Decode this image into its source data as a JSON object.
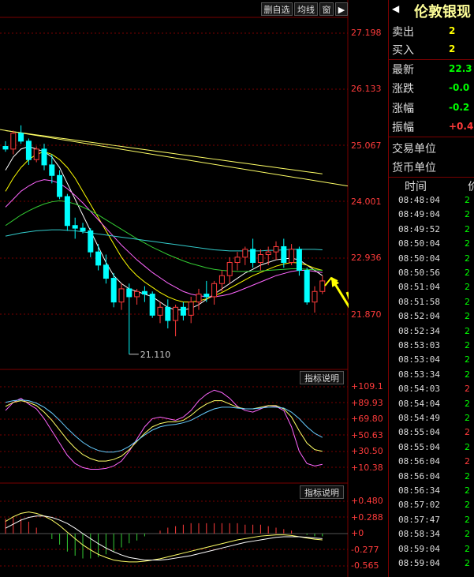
{
  "toolbar": {
    "buttons": [
      "删自选",
      "均线",
      "窗"
    ]
  },
  "chart_data": [
    {
      "type": "candlestick",
      "ylim": [
        20.0,
        27.6
      ],
      "y_ticks": [
        "27.198",
        "26.133",
        "25.067",
        "24.001",
        "22.936",
        "21.870"
      ],
      "low_annotation": "21.110",
      "candles": [
        {
          "o": 25.05,
          "h": 25.15,
          "l": 24.95,
          "c": 25.0
        },
        {
          "o": 25.0,
          "h": 25.35,
          "l": 24.9,
          "c": 25.3
        },
        {
          "o": 25.3,
          "h": 25.45,
          "l": 25.1,
          "c": 25.15
        },
        {
          "o": 25.15,
          "h": 25.2,
          "l": 24.7,
          "c": 24.8
        },
        {
          "o": 24.8,
          "h": 25.05,
          "l": 24.75,
          "c": 25.0
        },
        {
          "o": 25.0,
          "h": 25.1,
          "l": 24.6,
          "c": 24.7
        },
        {
          "o": 24.7,
          "h": 24.9,
          "l": 24.35,
          "c": 24.5
        },
        {
          "o": 24.5,
          "h": 24.6,
          "l": 24.05,
          "c": 24.1
        },
        {
          "o": 24.1,
          "h": 24.15,
          "l": 23.45,
          "c": 23.55
        },
        {
          "o": 23.55,
          "h": 23.7,
          "l": 23.3,
          "c": 23.5
        },
        {
          "o": 23.5,
          "h": 23.6,
          "l": 23.4,
          "c": 23.45
        },
        {
          "o": 23.45,
          "h": 23.5,
          "l": 22.95,
          "c": 23.05
        },
        {
          "o": 23.05,
          "h": 23.2,
          "l": 22.7,
          "c": 22.8
        },
        {
          "o": 22.8,
          "h": 23.0,
          "l": 22.45,
          "c": 22.55
        },
        {
          "o": 22.55,
          "h": 22.65,
          "l": 22.0,
          "c": 22.1
        },
        {
          "o": 22.1,
          "h": 22.45,
          "l": 21.95,
          "c": 22.35
        },
        {
          "o": 22.35,
          "h": 22.45,
          "l": 21.11,
          "c": 22.2
        },
        {
          "o": 22.2,
          "h": 22.35,
          "l": 22.05,
          "c": 22.3
        },
        {
          "o": 22.3,
          "h": 22.4,
          "l": 22.1,
          "c": 22.25
        },
        {
          "o": 22.25,
          "h": 22.3,
          "l": 21.8,
          "c": 21.85
        },
        {
          "o": 21.85,
          "h": 22.1,
          "l": 21.7,
          "c": 22.0
        },
        {
          "o": 22.0,
          "h": 22.15,
          "l": 21.6,
          "c": 21.75
        },
        {
          "o": 21.75,
          "h": 22.05,
          "l": 21.45,
          "c": 22.0
        },
        {
          "o": 22.0,
          "h": 22.1,
          "l": 21.75,
          "c": 21.85
        },
        {
          "o": 21.85,
          "h": 22.2,
          "l": 21.7,
          "c": 22.1
        },
        {
          "o": 22.1,
          "h": 22.35,
          "l": 21.95,
          "c": 22.25
        },
        {
          "o": 22.25,
          "h": 22.5,
          "l": 22.1,
          "c": 22.2
        },
        {
          "o": 22.2,
          "h": 22.5,
          "l": 22.05,
          "c": 22.45
        },
        {
          "o": 22.45,
          "h": 22.7,
          "l": 22.3,
          "c": 22.6
        },
        {
          "o": 22.6,
          "h": 22.95,
          "l": 22.45,
          "c": 22.85
        },
        {
          "o": 22.85,
          "h": 23.05,
          "l": 22.7,
          "c": 22.95
        },
        {
          "o": 22.95,
          "h": 23.15,
          "l": 22.8,
          "c": 23.1
        },
        {
          "o": 23.1,
          "h": 23.3,
          "l": 22.75,
          "c": 22.85
        },
        {
          "o": 22.85,
          "h": 23.1,
          "l": 22.7,
          "c": 23.0
        },
        {
          "o": 23.0,
          "h": 23.15,
          "l": 22.8,
          "c": 23.05
        },
        {
          "o": 23.05,
          "h": 23.25,
          "l": 22.9,
          "c": 23.15
        },
        {
          "o": 23.15,
          "h": 23.3,
          "l": 22.75,
          "c": 22.85
        },
        {
          "o": 22.85,
          "h": 23.2,
          "l": 22.8,
          "c": 23.1
        },
        {
          "o": 23.1,
          "h": 23.15,
          "l": 22.6,
          "c": 22.7
        },
        {
          "o": 22.7,
          "h": 22.75,
          "l": 22.05,
          "c": 22.1
        },
        {
          "o": 22.1,
          "h": 22.4,
          "l": 21.9,
          "c": 22.3
        },
        {
          "o": 22.3,
          "h": 22.6,
          "l": 22.25,
          "c": 22.5
        }
      ],
      "lines": [
        {
          "color": "#ffff66",
          "values": [
            25.35,
            25.33,
            25.31,
            25.29,
            25.27,
            25.25,
            25.23,
            25.21,
            25.19,
            25.17,
            25.15,
            25.13,
            25.11,
            25.09,
            25.07,
            25.05,
            25.03,
            25.01,
            24.99,
            24.97,
            24.95,
            24.93,
            24.91,
            24.89,
            24.87,
            24.85,
            24.83,
            24.81,
            24.79,
            24.77,
            24.75,
            24.73,
            24.71,
            24.69,
            24.67,
            24.65,
            24.63,
            24.61,
            24.59,
            24.57,
            24.55,
            24.53
          ]
        },
        {
          "color": "#ffffff",
          "values": [
            24.6,
            24.85,
            25.0,
            25.05,
            25.0,
            24.95,
            24.85,
            24.65,
            24.35,
            24.05,
            23.75,
            23.45,
            23.15,
            22.85,
            22.6,
            22.45,
            22.35,
            22.3,
            22.25,
            22.2,
            22.1,
            22.0,
            21.95,
            21.95,
            21.98,
            22.05,
            22.15,
            22.25,
            22.35,
            22.45,
            22.55,
            22.65,
            22.72,
            22.8,
            22.85,
            22.9,
            22.92,
            22.93,
            22.9,
            22.8,
            22.7,
            22.6
          ]
        },
        {
          "color": "#ffff00",
          "values": [
            24.2,
            24.45,
            24.65,
            24.8,
            24.9,
            24.95,
            24.9,
            24.8,
            24.65,
            24.45,
            24.2,
            23.95,
            23.7,
            23.45,
            23.2,
            22.95,
            22.75,
            22.6,
            22.48,
            22.38,
            22.28,
            22.2,
            22.14,
            22.1,
            22.1,
            22.12,
            22.16,
            22.22,
            22.28,
            22.36,
            22.44,
            22.52,
            22.6,
            22.66,
            22.72,
            22.78,
            22.82,
            22.85,
            22.84,
            22.8,
            22.74,
            22.7
          ]
        },
        {
          "color": "#ff66ff",
          "values": [
            23.9,
            24.05,
            24.2,
            24.3,
            24.38,
            24.42,
            24.4,
            24.35,
            24.25,
            24.12,
            23.98,
            23.82,
            23.66,
            23.5,
            23.34,
            23.18,
            23.04,
            22.9,
            22.78,
            22.66,
            22.56,
            22.46,
            22.38,
            22.3,
            22.25,
            22.22,
            22.2,
            22.2,
            22.22,
            22.25,
            22.3,
            22.36,
            22.42,
            22.48,
            22.54,
            22.6,
            22.64,
            22.68,
            22.7,
            22.7,
            22.68,
            22.66
          ]
        },
        {
          "color": "#33cc33",
          "values": [
            23.55,
            23.65,
            23.75,
            23.83,
            23.9,
            23.96,
            24.0,
            24.02,
            24.0,
            23.96,
            23.9,
            23.83,
            23.75,
            23.66,
            23.57,
            23.48,
            23.39,
            23.3,
            23.22,
            23.14,
            23.07,
            23.0,
            22.94,
            22.88,
            22.83,
            22.79,
            22.75,
            22.72,
            22.7,
            22.69,
            22.68,
            22.68,
            22.68,
            22.69,
            22.7,
            22.71,
            22.72,
            22.73,
            22.73,
            22.72,
            22.71,
            22.7
          ]
        },
        {
          "color": "#33cccc",
          "values": [
            23.35,
            23.38,
            23.41,
            23.43,
            23.45,
            23.46,
            23.47,
            23.47,
            23.46,
            23.45,
            23.43,
            23.41,
            23.39,
            23.37,
            23.35,
            23.33,
            23.31,
            23.29,
            23.27,
            23.25,
            23.23,
            23.21,
            23.19,
            23.17,
            23.15,
            23.13,
            23.11,
            23.09,
            23.08,
            23.07,
            23.07,
            23.07,
            23.07,
            23.07,
            23.08,
            23.08,
            23.09,
            23.1,
            23.1,
            23.1,
            23.1,
            23.09
          ]
        }
      ]
    },
    {
      "type": "line",
      "title": "指标说明",
      "ylim": [
        0,
        120
      ],
      "y_ticks": [
        "+109.1",
        "+89.93",
        "+69.80",
        "+50.63",
        "+30.50",
        "+10.38"
      ],
      "series": [
        {
          "color": "#ff66ff",
          "values": [
            80,
            90,
            95,
            88,
            82,
            70,
            55,
            40,
            25,
            15,
            10,
            8,
            8,
            9,
            12,
            18,
            30,
            45,
            60,
            70,
            72,
            70,
            68,
            72,
            80,
            92,
            100,
            105,
            102,
            95,
            85,
            80,
            78,
            82,
            86,
            85,
            80,
            60,
            30,
            15,
            12,
            14
          ]
        },
        {
          "color": "#ffff66",
          "values": [
            85,
            90,
            92,
            90,
            86,
            78,
            68,
            56,
            44,
            34,
            26,
            21,
            18,
            18,
            20,
            24,
            32,
            42,
            52,
            60,
            64,
            66,
            66,
            68,
            74,
            82,
            88,
            92,
            92,
            88,
            84,
            82,
            82,
            84,
            86,
            86,
            82,
            72,
            55,
            40,
            32,
            30
          ]
        },
        {
          "color": "#66ccff",
          "values": [
            90,
            92,
            93,
            92,
            89,
            84,
            77,
            68,
            58,
            49,
            41,
            35,
            31,
            29,
            29,
            31,
            36,
            43,
            50,
            56,
            60,
            62,
            63,
            65,
            68,
            73,
            78,
            82,
            84,
            84,
            83,
            82,
            82,
            83,
            84,
            84,
            83,
            78,
            70,
            60,
            52,
            47
          ]
        }
      ]
    },
    {
      "type": "line",
      "title": "指标说明",
      "ylim": [
        -0.6,
        0.5
      ],
      "y_ticks": [
        "+0.480",
        "+0.288",
        "+0",
        "-0.277",
        "-0.565"
      ],
      "series": [
        {
          "color": "#ffff66",
          "values": [
            0.18,
            0.25,
            0.3,
            0.32,
            0.3,
            0.26,
            0.2,
            0.12,
            0.02,
            -0.08,
            -0.18,
            -0.26,
            -0.33,
            -0.38,
            -0.42,
            -0.44,
            -0.45,
            -0.45,
            -0.44,
            -0.42,
            -0.4,
            -0.37,
            -0.34,
            -0.31,
            -0.28,
            -0.25,
            -0.22,
            -0.19,
            -0.16,
            -0.13,
            -0.1,
            -0.08,
            -0.06,
            -0.04,
            -0.03,
            -0.02,
            -0.02,
            -0.03,
            -0.05,
            -0.07,
            -0.09,
            -0.1
          ]
        },
        {
          "color": "#ffffff",
          "values": [
            0.08,
            0.14,
            0.2,
            0.24,
            0.26,
            0.26,
            0.24,
            0.2,
            0.15,
            0.08,
            0.0,
            -0.08,
            -0.16,
            -0.23,
            -0.29,
            -0.34,
            -0.38,
            -0.4,
            -0.42,
            -0.42,
            -0.42,
            -0.41,
            -0.39,
            -0.37,
            -0.35,
            -0.32,
            -0.29,
            -0.26,
            -0.23,
            -0.2,
            -0.17,
            -0.14,
            -0.12,
            -0.1,
            -0.08,
            -0.06,
            -0.05,
            -0.05,
            -0.05,
            -0.06,
            -0.07,
            -0.08
          ]
        }
      ],
      "histogram": [
        0.2,
        0.22,
        0.2,
        0.16,
        0.08,
        0.0,
        -0.08,
        -0.16,
        -0.26,
        -0.32,
        -0.36,
        -0.36,
        -0.34,
        -0.3,
        -0.26,
        -0.2,
        -0.14,
        -0.1,
        -0.04,
        0.0,
        0.04,
        0.08,
        0.1,
        0.12,
        0.14,
        0.14,
        0.14,
        0.14,
        0.14,
        0.14,
        0.14,
        0.12,
        0.12,
        0.12,
        0.1,
        0.08,
        0.06,
        0.04,
        0.0,
        -0.02,
        -0.04,
        -0.04
      ]
    }
  ],
  "quote_panel": {
    "title": "伦敦银现",
    "rows": [
      {
        "label": "卖出",
        "value": "2",
        "color": "#ffff00"
      },
      {
        "label": "买入",
        "value": "2",
        "color": "#ffff00"
      },
      {
        "label": "最新",
        "value": "22.3",
        "color": "#00ff00"
      },
      {
        "label": "涨跌",
        "value": "-0.0",
        "color": "#00ff00"
      },
      {
        "label": "涨幅",
        "value": "-0.2",
        "color": "#00ff00"
      },
      {
        "label": "振幅",
        "value": "+0.4",
        "color": "#ff3b3b"
      },
      {
        "label": "交易单位",
        "value": "",
        "color": "#ddd"
      },
      {
        "label": "货币单位",
        "value": "",
        "color": "#ddd"
      }
    ],
    "ticks_header": "时间",
    "ticks_header_right": "价",
    "ticks": [
      {
        "time": "08:48:04",
        "v": "2",
        "c": "#00ff00"
      },
      {
        "time": "08:49:04",
        "v": "2",
        "c": "#00ff00"
      },
      {
        "time": "08:49:52",
        "v": "2",
        "c": "#00ff00"
      },
      {
        "time": "08:50:04",
        "v": "2",
        "c": "#00ff00"
      },
      {
        "time": "08:50:04",
        "v": "2",
        "c": "#00ff00"
      },
      {
        "time": "08:50:56",
        "v": "2",
        "c": "#00ff00"
      },
      {
        "time": "08:51:04",
        "v": "2",
        "c": "#00ff00"
      },
      {
        "time": "08:51:58",
        "v": "2",
        "c": "#00ff00"
      },
      {
        "time": "08:52:04",
        "v": "2",
        "c": "#00ff00"
      },
      {
        "time": "08:52:34",
        "v": "2",
        "c": "#00ff00"
      },
      {
        "time": "08:53:03",
        "v": "2",
        "c": "#00ff00"
      },
      {
        "time": "08:53:04",
        "v": "2",
        "c": "#00ff00"
      },
      {
        "time": "08:53:34",
        "v": "2",
        "c": "#00ff00"
      },
      {
        "time": "08:54:03",
        "v": "2",
        "c": "#ff3b3b"
      },
      {
        "time": "08:54:04",
        "v": "2",
        "c": "#00ff00"
      },
      {
        "time": "08:54:49",
        "v": "2",
        "c": "#00ff00"
      },
      {
        "time": "08:55:04",
        "v": "2",
        "c": "#ff3b3b"
      },
      {
        "time": "08:55:04",
        "v": "2",
        "c": "#00ff00"
      },
      {
        "time": "08:56:04",
        "v": "2",
        "c": "#ff3b3b"
      },
      {
        "time": "08:56:04",
        "v": "2",
        "c": "#00ff00"
      },
      {
        "time": "08:56:34",
        "v": "2",
        "c": "#00ff00"
      },
      {
        "time": "08:57:02",
        "v": "2",
        "c": "#00ff00"
      },
      {
        "time": "08:57:47",
        "v": "2",
        "c": "#00ff00"
      },
      {
        "time": "08:58:34",
        "v": "2",
        "c": "#00ff00"
      },
      {
        "time": "08:59:04",
        "v": "2",
        "c": "#00ff00"
      },
      {
        "time": "08:59:04",
        "v": "2",
        "c": "#00ff00"
      }
    ]
  },
  "colors": {
    "up": "#ff3b3b",
    "down": "#00ffff",
    "arrow": "#ffff00",
    "grid": "#7a0000"
  }
}
